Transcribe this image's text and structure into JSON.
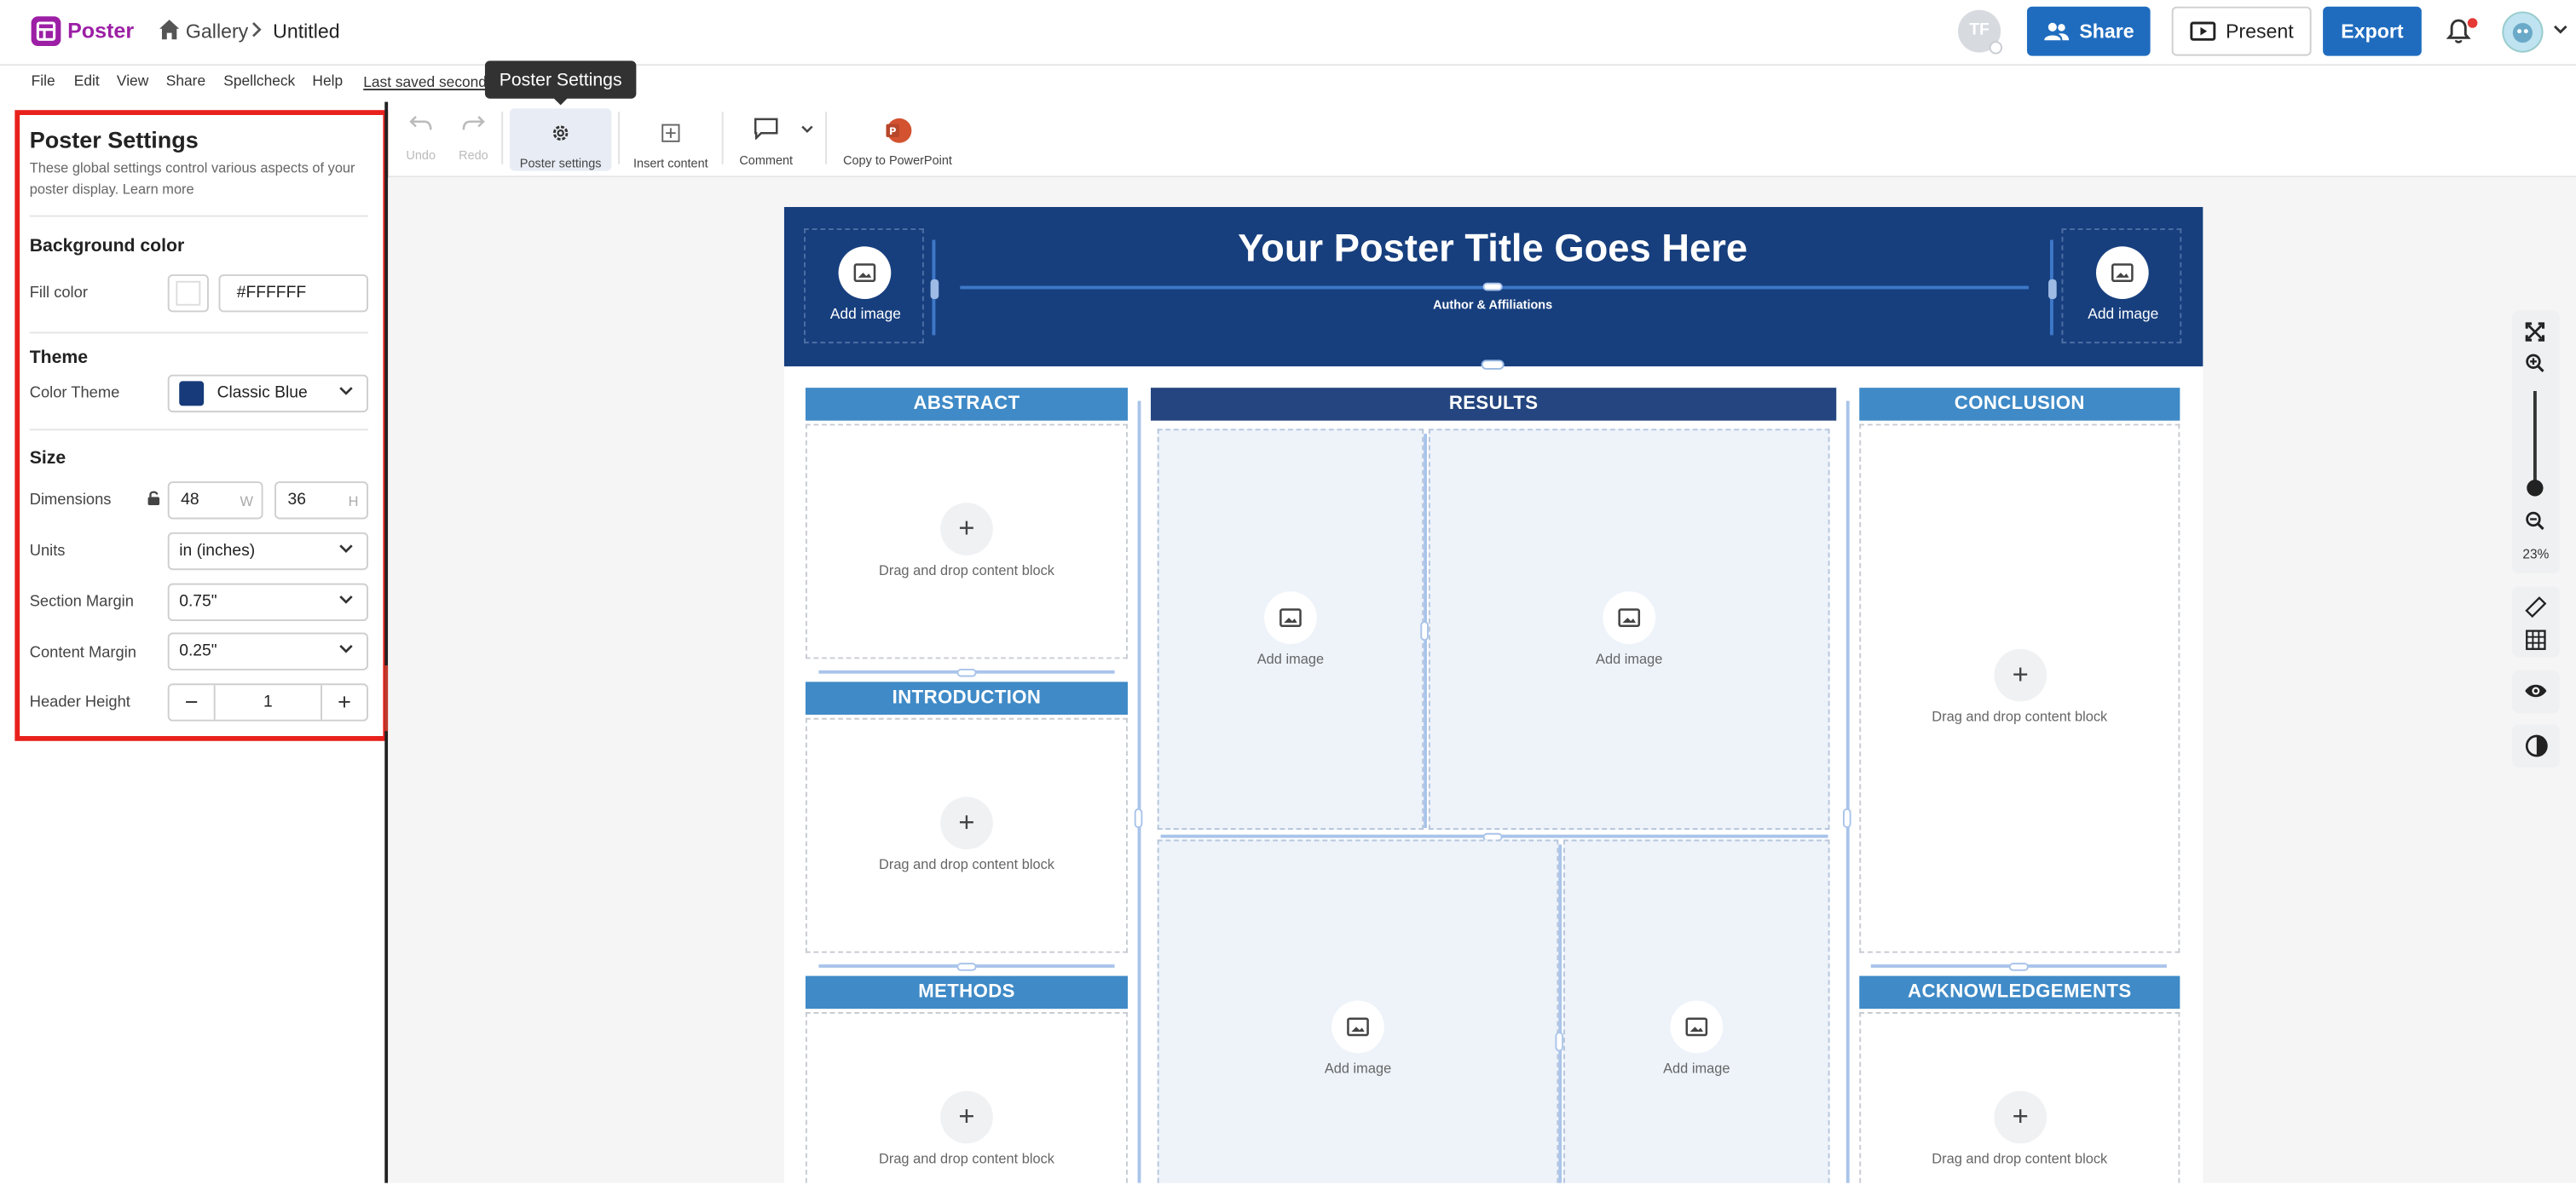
{
  "app": {
    "logo_text": "Poster",
    "breadcrumb": {
      "home_label": "Gallery",
      "document_title": "Untitled"
    },
    "accent_color": "#9c1fa5",
    "primary_color": "#1f6cbf"
  },
  "header_right": {
    "collaborator_initials": "TF",
    "share_label": "Share",
    "present_label": "Present",
    "export_label": "Export"
  },
  "menu": {
    "items": [
      "File",
      "Edit",
      "View",
      "Share",
      "Spellcheck",
      "Help"
    ],
    "last_saved": "Last saved second"
  },
  "tooltip": {
    "text": "Poster Settings"
  },
  "settings_panel": {
    "title": "Poster Settings",
    "description": "These global settings control various aspects of your poster display.",
    "learn_more": "Learn more",
    "background": {
      "heading": "Background color",
      "fill_label": "Fill color",
      "fill_value": "#FFFFFF"
    },
    "theme": {
      "heading": "Theme",
      "color_theme_label": "Color Theme",
      "color_theme_value": "Classic Blue",
      "theme_color": "#173b7a"
    },
    "size": {
      "heading": "Size",
      "dimensions_label": "Dimensions",
      "width_value": "48",
      "width_unit": "W",
      "height_value": "36",
      "height_unit": "H",
      "units_label": "Units",
      "units_value": "in (inches)",
      "section_margin_label": "Section Margin",
      "section_margin_value": "0.75\"",
      "content_margin_label": "Content Margin",
      "content_margin_value": "0.25\"",
      "header_height_label": "Header Height",
      "header_height_value": "1"
    }
  },
  "toolbar": {
    "undo": "Undo",
    "redo": "Redo",
    "poster_settings": "Poster settings",
    "insert_content": "Insert content",
    "comment": "Comment",
    "copy_ppt": "Copy to PowerPoint"
  },
  "poster": {
    "title": "Your Poster Title Goes Here",
    "authors": "Author & Affiliations",
    "header_image_label": "Add image",
    "header_color": "#173f7e",
    "sections": {
      "abstract": "ABSTRACT",
      "introduction": "INTRODUCTION",
      "methods": "METHODS",
      "results": "RESULTS",
      "conclusion": "CONCLUSION",
      "acknowledgements": "ACKNOWLEDGEMENTS"
    },
    "drag_label": "Drag and drop content block",
    "add_image_label": "Add image"
  },
  "zoom": {
    "level": "23%"
  }
}
